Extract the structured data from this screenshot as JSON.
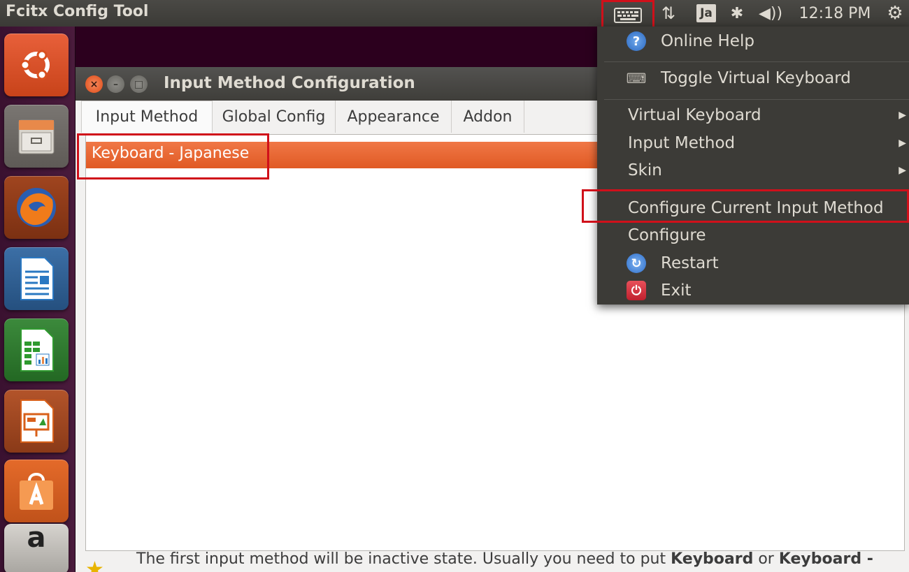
{
  "top_panel": {
    "app_title": "Fcitx Config Tool",
    "keyboard_indicator": "⌨",
    "network_icon": "⇅",
    "input_method_indicator": "Ja",
    "bluetooth_icon": "✱",
    "volume_icon": "◀))",
    "clock": "12:18 PM",
    "session_icon": "⚙"
  },
  "launcher": {
    "items": [
      {
        "name": "ubuntu-dash",
        "color": "#dd4814"
      },
      {
        "name": "files",
        "color": "#8b8782"
      },
      {
        "name": "firefox",
        "color": "#e66000"
      },
      {
        "name": "libreoffice-writer",
        "color": "#2a78c2"
      },
      {
        "name": "libreoffice-calc",
        "color": "#2f9a2f"
      },
      {
        "name": "libreoffice-impress",
        "color": "#d8601a"
      },
      {
        "name": "ubuntu-software-center",
        "color": "#f08a40"
      },
      {
        "name": "amazon",
        "color": "#c9c6c0"
      }
    ],
    "amazon_label": "a"
  },
  "window": {
    "title": "Input Method Configuration",
    "close_glyph": "×",
    "min_glyph": "–",
    "max_glyph": "□",
    "tabs": [
      {
        "label": "Input Method",
        "active": true
      },
      {
        "label": "Global Config",
        "active": false
      },
      {
        "label": "Appearance",
        "active": false
      },
      {
        "label": "Addon",
        "active": false
      }
    ],
    "input_methods": [
      "Keyboard - Japanese"
    ],
    "hint_prefix": "The first input method will be inactive state. Usually you need to put ",
    "hint_bold_1": "Keyboard",
    "hint_middle": " or ",
    "hint_bold_2": "Keyboard -"
  },
  "tray_menu": {
    "items": [
      {
        "label": "Online Help",
        "icon": "help-icon",
        "submenu": false
      },
      {
        "label": "Toggle Virtual Keyboard",
        "icon": "keyboard-icon",
        "submenu": false
      },
      {
        "label": "Virtual Keyboard",
        "submenu": true
      },
      {
        "label": "Input Method",
        "submenu": true
      },
      {
        "label": "Skin",
        "submenu": true
      },
      {
        "label": "Configure Current Input Method",
        "submenu": false
      },
      {
        "label": "Configure",
        "submenu": false
      },
      {
        "label": "Restart",
        "icon": "restart-icon",
        "submenu": false
      },
      {
        "label": "Exit",
        "icon": "exit-icon",
        "submenu": false
      }
    ],
    "help_glyph": "?",
    "keyboard_glyph": "⌨",
    "restart_glyph": "↻",
    "exit_glyph": "⏻",
    "arrow_glyph": "▶"
  },
  "colors": {
    "highlight": "#d0101a",
    "selection": "#e96a33",
    "panel": "#3c3b37"
  }
}
